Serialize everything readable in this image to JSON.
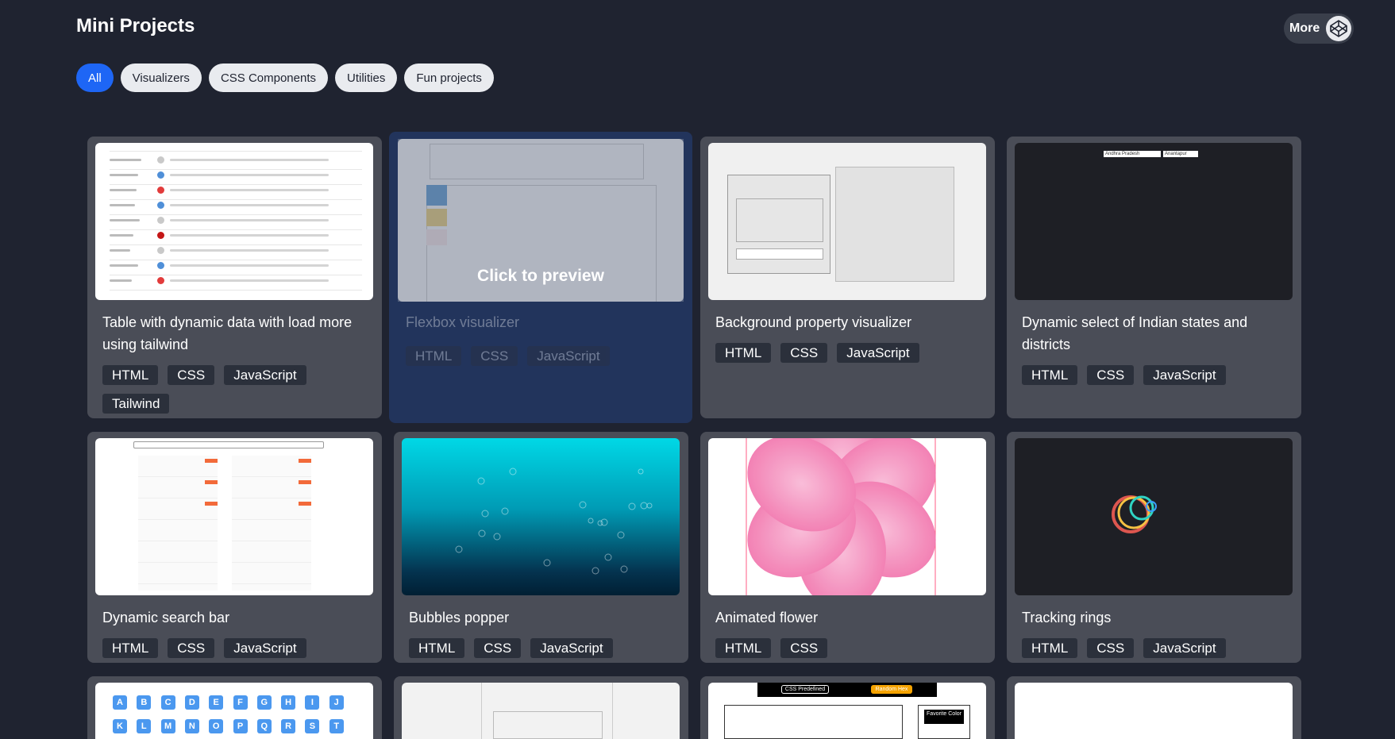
{
  "header": {
    "title": "Mini Projects",
    "more_label": "More",
    "more_icon": "codepen-icon"
  },
  "filters": [
    {
      "label": "All",
      "active": true
    },
    {
      "label": "Visualizers",
      "active": false
    },
    {
      "label": "CSS Components",
      "active": false
    },
    {
      "label": "Utilities",
      "active": false
    },
    {
      "label": "Fun projects",
      "active": false
    }
  ],
  "preview_label": "Click to preview",
  "cards": [
    {
      "title": "Table with dynamic data with load more using tailwind",
      "tags": [
        "HTML",
        "CSS",
        "JavaScript",
        "Tailwind"
      ]
    },
    {
      "title": "Flexbox visualizer",
      "tags": [
        "HTML",
        "CSS",
        "JavaScript"
      ]
    },
    {
      "title": "Background property visualizer",
      "tags": [
        "HTML",
        "CSS",
        "JavaScript"
      ]
    },
    {
      "title": "Dynamic select of Indian states and districts",
      "tags": [
        "HTML",
        "CSS",
        "JavaScript"
      ],
      "thumb_text": [
        "Andhra Pradesh",
        "Anantapur"
      ]
    },
    {
      "title": "Dynamic search bar",
      "tags": [
        "HTML",
        "CSS",
        "JavaScript"
      ]
    },
    {
      "title": "Bubbles popper",
      "tags": [
        "HTML",
        "CSS",
        "JavaScript"
      ]
    },
    {
      "title": "Animated flower",
      "tags": [
        "HTML",
        "CSS"
      ]
    },
    {
      "title": "Tracking rings",
      "tags": [
        "HTML",
        "CSS",
        "JavaScript"
      ]
    }
  ],
  "partial_cards": [
    {
      "thumb_text": [
        "A",
        "B",
        "C",
        "D",
        "E",
        "F",
        "G",
        "H",
        "I",
        "J",
        "K",
        "L",
        "M",
        "N",
        "O",
        "P",
        "Q",
        "R",
        "S",
        "T"
      ]
    },
    {
      "thumb_text": []
    },
    {
      "thumb_text": [
        "CSS Predefined",
        "Random Hex",
        "Favorite Color"
      ]
    },
    {
      "thumb_text": []
    }
  ],
  "colors": {
    "background": "#1f2330",
    "card": "#4a4d57",
    "card_hover": "#22345c",
    "chip_active": "#1e66f5",
    "tag": "#2b303b"
  }
}
